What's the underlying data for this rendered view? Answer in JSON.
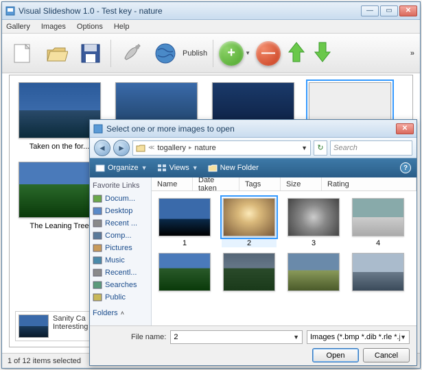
{
  "main_window": {
    "title": "Visual Slideshow 1.0 - Test key - nature",
    "menu": {
      "gallery": "Gallery",
      "images": "Images",
      "options": "Options",
      "help": "Help"
    },
    "toolbar": {
      "publish": "Publish"
    },
    "thumbs": [
      {
        "caption": "Taken on the for...",
        "selected": false
      },
      {
        "caption": "",
        "selected": false
      },
      {
        "caption": "",
        "selected": false
      },
      {
        "caption": "",
        "selected": true
      },
      {
        "caption": "The Leaning Tree"
      }
    ],
    "info_box": "Sanity Ca\nInteresting",
    "status": "1 of 12 items selected"
  },
  "dialog": {
    "title": "Select one or more images to open",
    "breadcrumb": {
      "p1": "togallery",
      "p2": "nature"
    },
    "search_placeholder": "Search",
    "toolbar": {
      "organize": "Organize",
      "views": "Views",
      "newfolder": "New Folder"
    },
    "fav_header": "Favorite Links",
    "fav_items": [
      {
        "label": "Docum..."
      },
      {
        "label": "Desktop"
      },
      {
        "label": "Recent ..."
      },
      {
        "label": "Comp..."
      },
      {
        "label": "Pictures"
      },
      {
        "label": "Music"
      },
      {
        "label": "Recentl..."
      },
      {
        "label": "Searches"
      },
      {
        "label": "Public"
      }
    ],
    "fav_footer": "Folders",
    "columns": {
      "name": "Name",
      "date": "Date taken",
      "tags": "Tags",
      "size": "Size",
      "rating": "Rating"
    },
    "files": [
      {
        "label": "1",
        "cls": "t1",
        "sel": false
      },
      {
        "label": "2",
        "cls": "t2",
        "sel": true
      },
      {
        "label": "3",
        "cls": "t3",
        "sel": false
      },
      {
        "label": "4",
        "cls": "t4",
        "sel": false
      },
      {
        "label": "",
        "cls": "t5",
        "sel": false
      },
      {
        "label": "",
        "cls": "t6",
        "sel": false
      },
      {
        "label": "",
        "cls": "t7",
        "sel": false
      },
      {
        "label": "",
        "cls": "t8",
        "sel": false
      }
    ],
    "filename_label": "File name:",
    "filename_value": "2",
    "filter": "Images (*.bmp *.dib *.rle *.jpg",
    "open": "Open",
    "cancel": "Cancel"
  }
}
